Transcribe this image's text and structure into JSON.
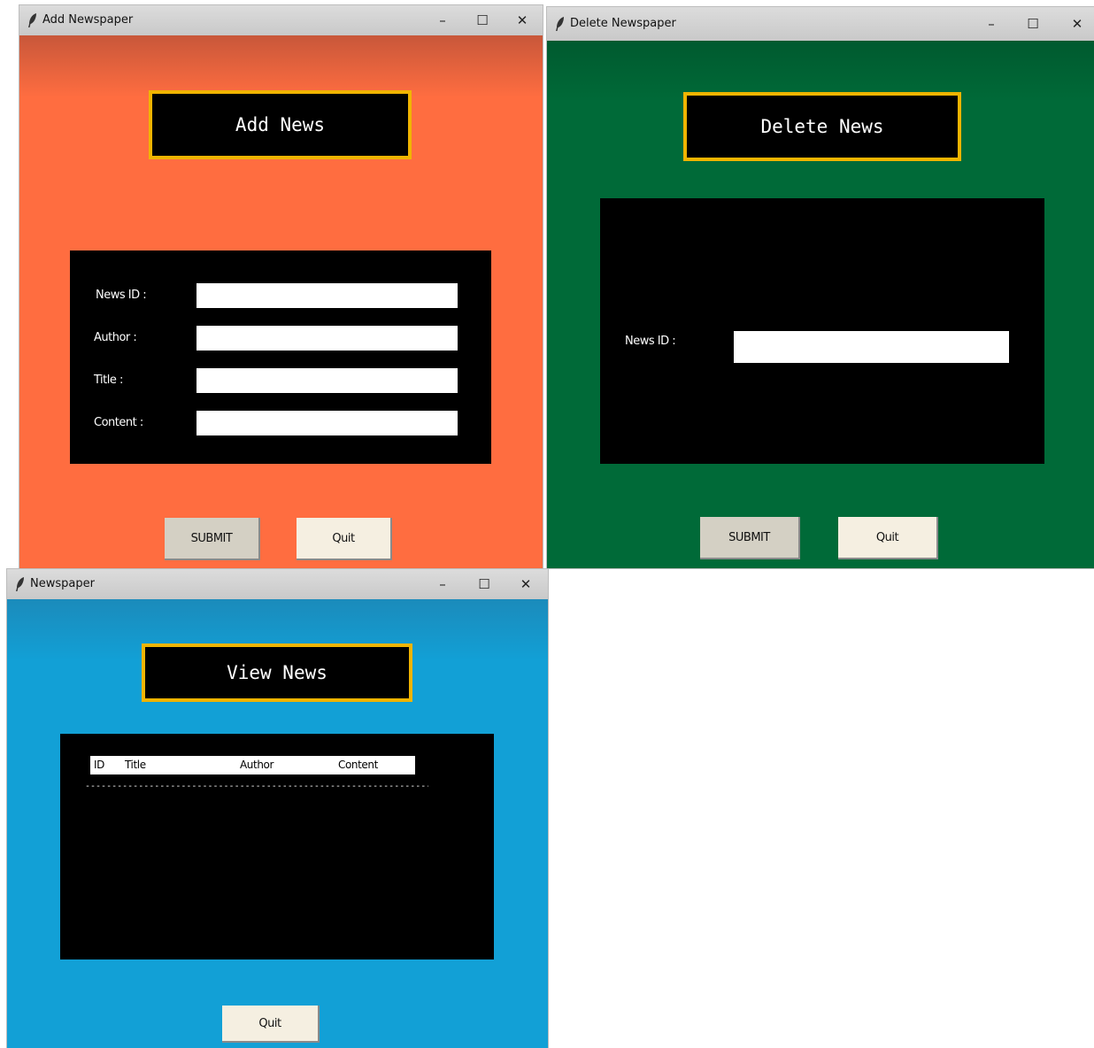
{
  "add_window": {
    "title": "Add Newspaper",
    "heading": "Add News",
    "fields": [
      {
        "label": "News ID :",
        "value": ""
      },
      {
        "label": "Author :",
        "value": ""
      },
      {
        "label": "Title :",
        "value": ""
      },
      {
        "label": "Content :",
        "value": ""
      }
    ],
    "submit_label": "SUBMIT",
    "quit_label": "Quit",
    "bg_color": "#ff6d40"
  },
  "delete_window": {
    "title": "Delete Newspaper",
    "heading": "Delete News",
    "field": {
      "label": "News ID :",
      "value": ""
    },
    "submit_label": "SUBMIT",
    "quit_label": "Quit",
    "bg_color": "#006a38"
  },
  "view_window": {
    "title": "Newspaper",
    "heading": "View News",
    "columns": [
      "ID",
      "Title",
      "Author",
      "Content"
    ],
    "separator": "-------------------------------------------------------------------------------",
    "quit_label": "Quit",
    "bg_color": "#12a0d6"
  },
  "window_controls": {
    "minimize": "–",
    "maximize": "☐",
    "close": "✕"
  },
  "accent_border": "#f0b400"
}
